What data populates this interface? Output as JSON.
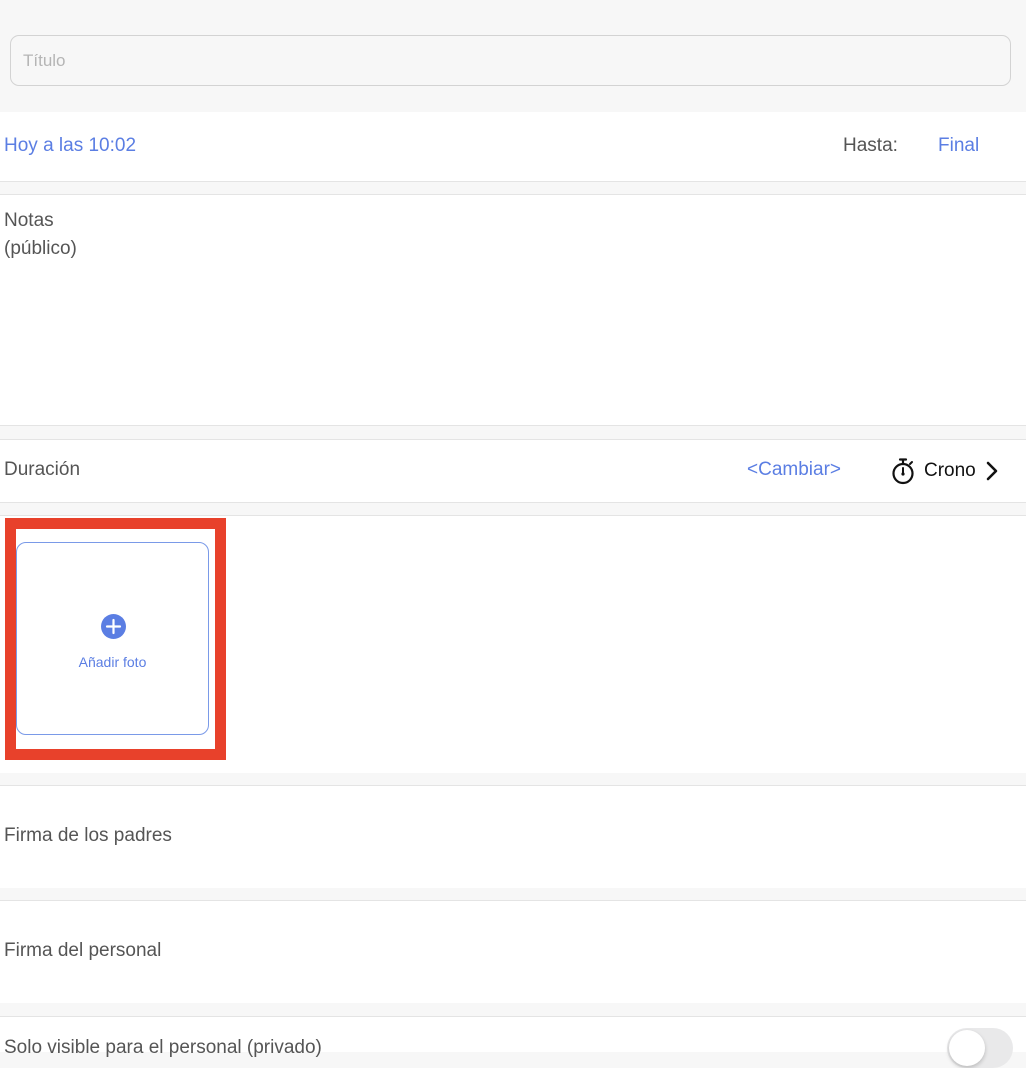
{
  "title_field": {
    "placeholder": "Título",
    "value": ""
  },
  "date_row": {
    "start_label": "Hoy a las 10:02",
    "until_label": "Hasta:",
    "end_value": "Final"
  },
  "notes": {
    "label_line1": "Notas",
    "label_line2": "(público)",
    "value": ""
  },
  "duration": {
    "label": "Duración",
    "change_label": "<Cambiar>",
    "timer_label": "Crono"
  },
  "photo": {
    "add_label": "Añadir foto"
  },
  "signatures": {
    "parents_label": "Firma de los padres",
    "staff_label": "Firma del personal"
  },
  "privacy": {
    "label": "Solo visible para el personal (privado)",
    "enabled": false
  },
  "colors": {
    "accent": "#5b7ee3",
    "highlight": "#e8412b",
    "background": "#f7f7f7"
  },
  "icons": {
    "timer": "stopwatch-icon",
    "chevron": "chevron-right-icon",
    "add_photo": "plus-circle-icon"
  }
}
